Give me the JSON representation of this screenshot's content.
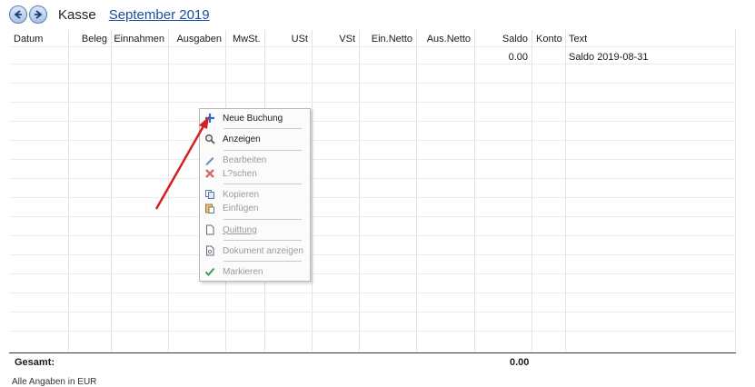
{
  "header": {
    "title": "Kasse",
    "period": "September 2019"
  },
  "columns": [
    {
      "key": "datum",
      "label": "Datum"
    },
    {
      "key": "beleg",
      "label": "Beleg"
    },
    {
      "key": "einnahmen",
      "label": "Einnahmen"
    },
    {
      "key": "ausgaben",
      "label": "Ausgaben"
    },
    {
      "key": "mwst",
      "label": "MwSt."
    },
    {
      "key": "ust",
      "label": "USt"
    },
    {
      "key": "vst",
      "label": "VSt"
    },
    {
      "key": "einnetto",
      "label": "Ein.Netto"
    },
    {
      "key": "ausnetto",
      "label": "Aus.Netto"
    },
    {
      "key": "saldo",
      "label": "Saldo"
    },
    {
      "key": "konto",
      "label": "Konto"
    },
    {
      "key": "text",
      "label": "Text"
    }
  ],
  "rows": [
    {
      "saldo": "0.00",
      "text": "Saldo 2019-08-31"
    }
  ],
  "footer": {
    "total_label": "Gesamt:",
    "total_value": "0.00",
    "currency_note": "Alle Angaben in EUR"
  },
  "context_menu": {
    "items": [
      {
        "label": "Neue Buchung",
        "icon": "plus-icon",
        "enabled": true
      },
      {
        "label": "Anzeigen",
        "icon": "magnifier-icon",
        "enabled": true
      },
      {
        "label": "Bearbeiten",
        "icon": "pencil-icon",
        "enabled": false
      },
      {
        "label": "L?schen",
        "icon": "delete-x-icon",
        "enabled": false
      },
      {
        "label": "Kopieren",
        "icon": "copy-icon",
        "enabled": false
      },
      {
        "label": "Einfügen",
        "icon": "paste-icon",
        "enabled": false
      },
      {
        "label": "Quittung",
        "icon": "document-icon",
        "enabled": false
      },
      {
        "label": "Dokument anzeigen",
        "icon": "document-view-icon",
        "enabled": false
      },
      {
        "label": "Markieren",
        "icon": "checkmark-icon",
        "enabled": false
      }
    ]
  },
  "colors": {
    "accent": "#1a4fa0",
    "arrow": "#d42020",
    "disabled_text": "#9a9a9a"
  }
}
